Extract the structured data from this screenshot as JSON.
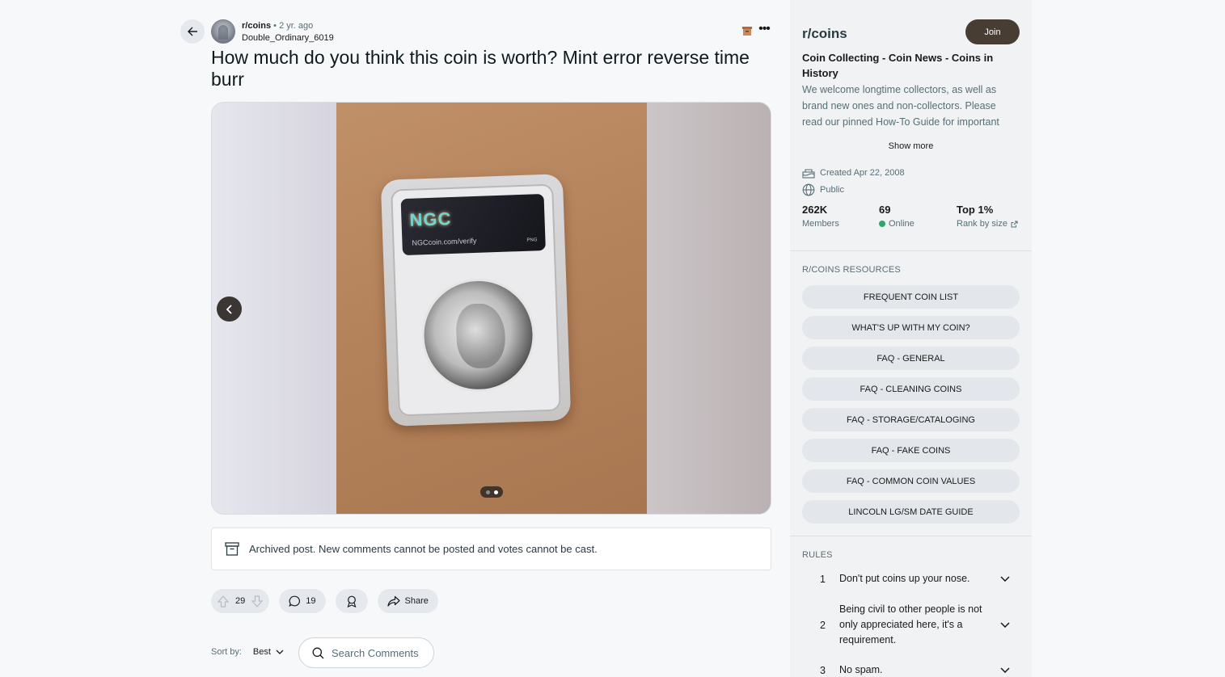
{
  "post": {
    "subreddit": "r/coins",
    "separator": "•",
    "age": "2 yr. ago",
    "author": "Double_Ordinary_6019",
    "title": "How much do you think this coin is worth? Mint error reverse time burr",
    "more_icon": "more-icon",
    "media": {
      "slab_label_brand": "NGC",
      "slab_label_url": "NGCcoin.com/verify",
      "slab_label_grade": "PNG",
      "gallery_total": 2,
      "gallery_current": 2
    },
    "archived_notice": "Archived post. New comments cannot be posted and votes cannot be cast.",
    "votes": "29",
    "comments": "19",
    "share_label": "Share"
  },
  "comments_bar": {
    "sort_label": "Sort by:",
    "sort_value": "Best",
    "search_placeholder": "Search Comments"
  },
  "sidebar": {
    "name": "r/coins",
    "join_label": "Join",
    "title": "Coin Collecting - Coin News - Coins in History",
    "description": "We welcome longtime collectors, as well as brand new ones and non-collectors. Please read our pinned How-To Guide for important information.",
    "show_more": "Show more",
    "created": "Created Apr 22, 2008",
    "visibility": "Public",
    "stats": [
      {
        "value": "262K",
        "label": "Members"
      },
      {
        "value": "69",
        "label": "Online"
      },
      {
        "value": "Top 1%",
        "label": "Rank by size"
      }
    ],
    "resources_heading": "R/COINS RESOURCES",
    "resources": [
      "FREQUENT COIN LIST",
      "WHAT'S UP WITH MY COIN?",
      "FAQ - GENERAL",
      "FAQ - CLEANING COINS",
      "FAQ - STORAGE/CATALOGING",
      "FAQ - FAKE COINS",
      "FAQ - COMMON COIN VALUES",
      "LINCOLN LG/SM DATE GUIDE"
    ],
    "rules_heading": "RULES",
    "rules": [
      {
        "num": "1",
        "text": "Don't put coins up your nose."
      },
      {
        "num": "2",
        "text": "Being civil to other people is not only appreciated here, it's a requirement."
      },
      {
        "num": "3",
        "text": "No spam."
      }
    ]
  },
  "colors": {
    "join_bg": "#473d33",
    "online": "#2ea868",
    "page_bg": "#f6f8fa"
  }
}
